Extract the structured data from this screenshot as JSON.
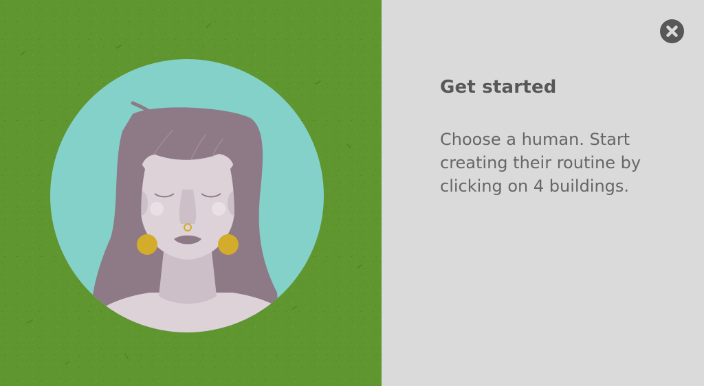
{
  "panel": {
    "title": "Get started",
    "body": "Choose a human. Start creating their routine by clicking on 4 buildings.",
    "close_label": "Close"
  },
  "icons": {
    "close": "close-icon",
    "portrait": "woman-avatar-illustration"
  },
  "colors": {
    "grass": "#5f9630",
    "panel_bg": "#d9dad9",
    "portrait_bg": "#84d1ca",
    "hair": "#8e7a86",
    "skin": "#ddd2d8",
    "earrings": "#d2ac2a",
    "text_dark": "#575757",
    "text_body": "#666666"
  }
}
